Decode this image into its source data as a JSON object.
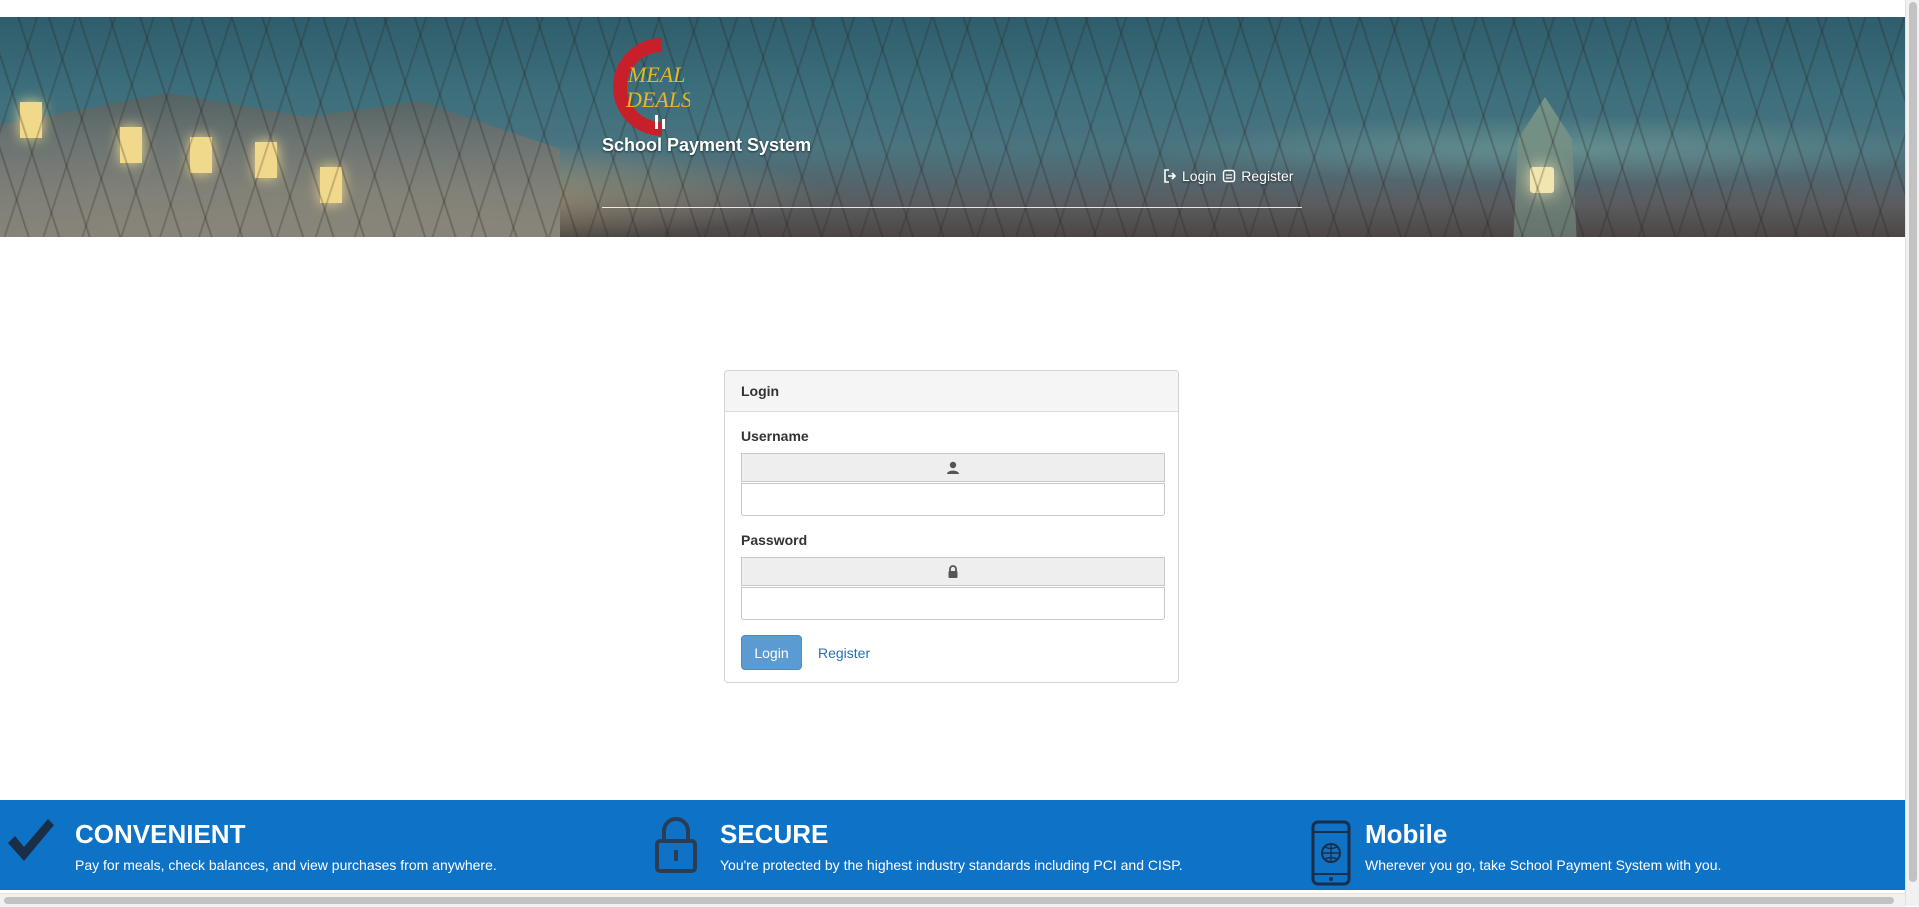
{
  "header": {
    "logo_icon": "meal-deals-logo",
    "logo_text_line1": "MEAL",
    "logo_text_line2": "DEALS",
    "site_title": "School Payment System",
    "nav": [
      {
        "icon": "login-icon",
        "label": "Login"
      },
      {
        "icon": "register-icon",
        "label": "Register"
      }
    ]
  },
  "login_panel": {
    "heading": "Login",
    "username": {
      "label": "Username",
      "icon": "user-icon",
      "value": ""
    },
    "password": {
      "label": "Password",
      "icon": "lock-icon",
      "value": ""
    },
    "login_button": "Login",
    "register_link": "Register"
  },
  "features": [
    {
      "icon": "checkmark-icon",
      "title": "CONVENIENT",
      "desc": "Pay for meals, check balances, and view purchases from anywhere."
    },
    {
      "icon": "padlock-icon",
      "title": "SECURE",
      "desc": "You're protected by the highest industry standards including PCI and CISP."
    },
    {
      "icon": "mobile-phone-icon",
      "title": "Mobile",
      "desc": "Wherever you go, take School Payment System with you."
    }
  ],
  "colors": {
    "feature_band": "#0e72c6",
    "primary_button": "#5c9bd2",
    "link": "#2a6fb0",
    "logo_red": "#c8202b",
    "logo_yellow": "#e7b62a"
  }
}
